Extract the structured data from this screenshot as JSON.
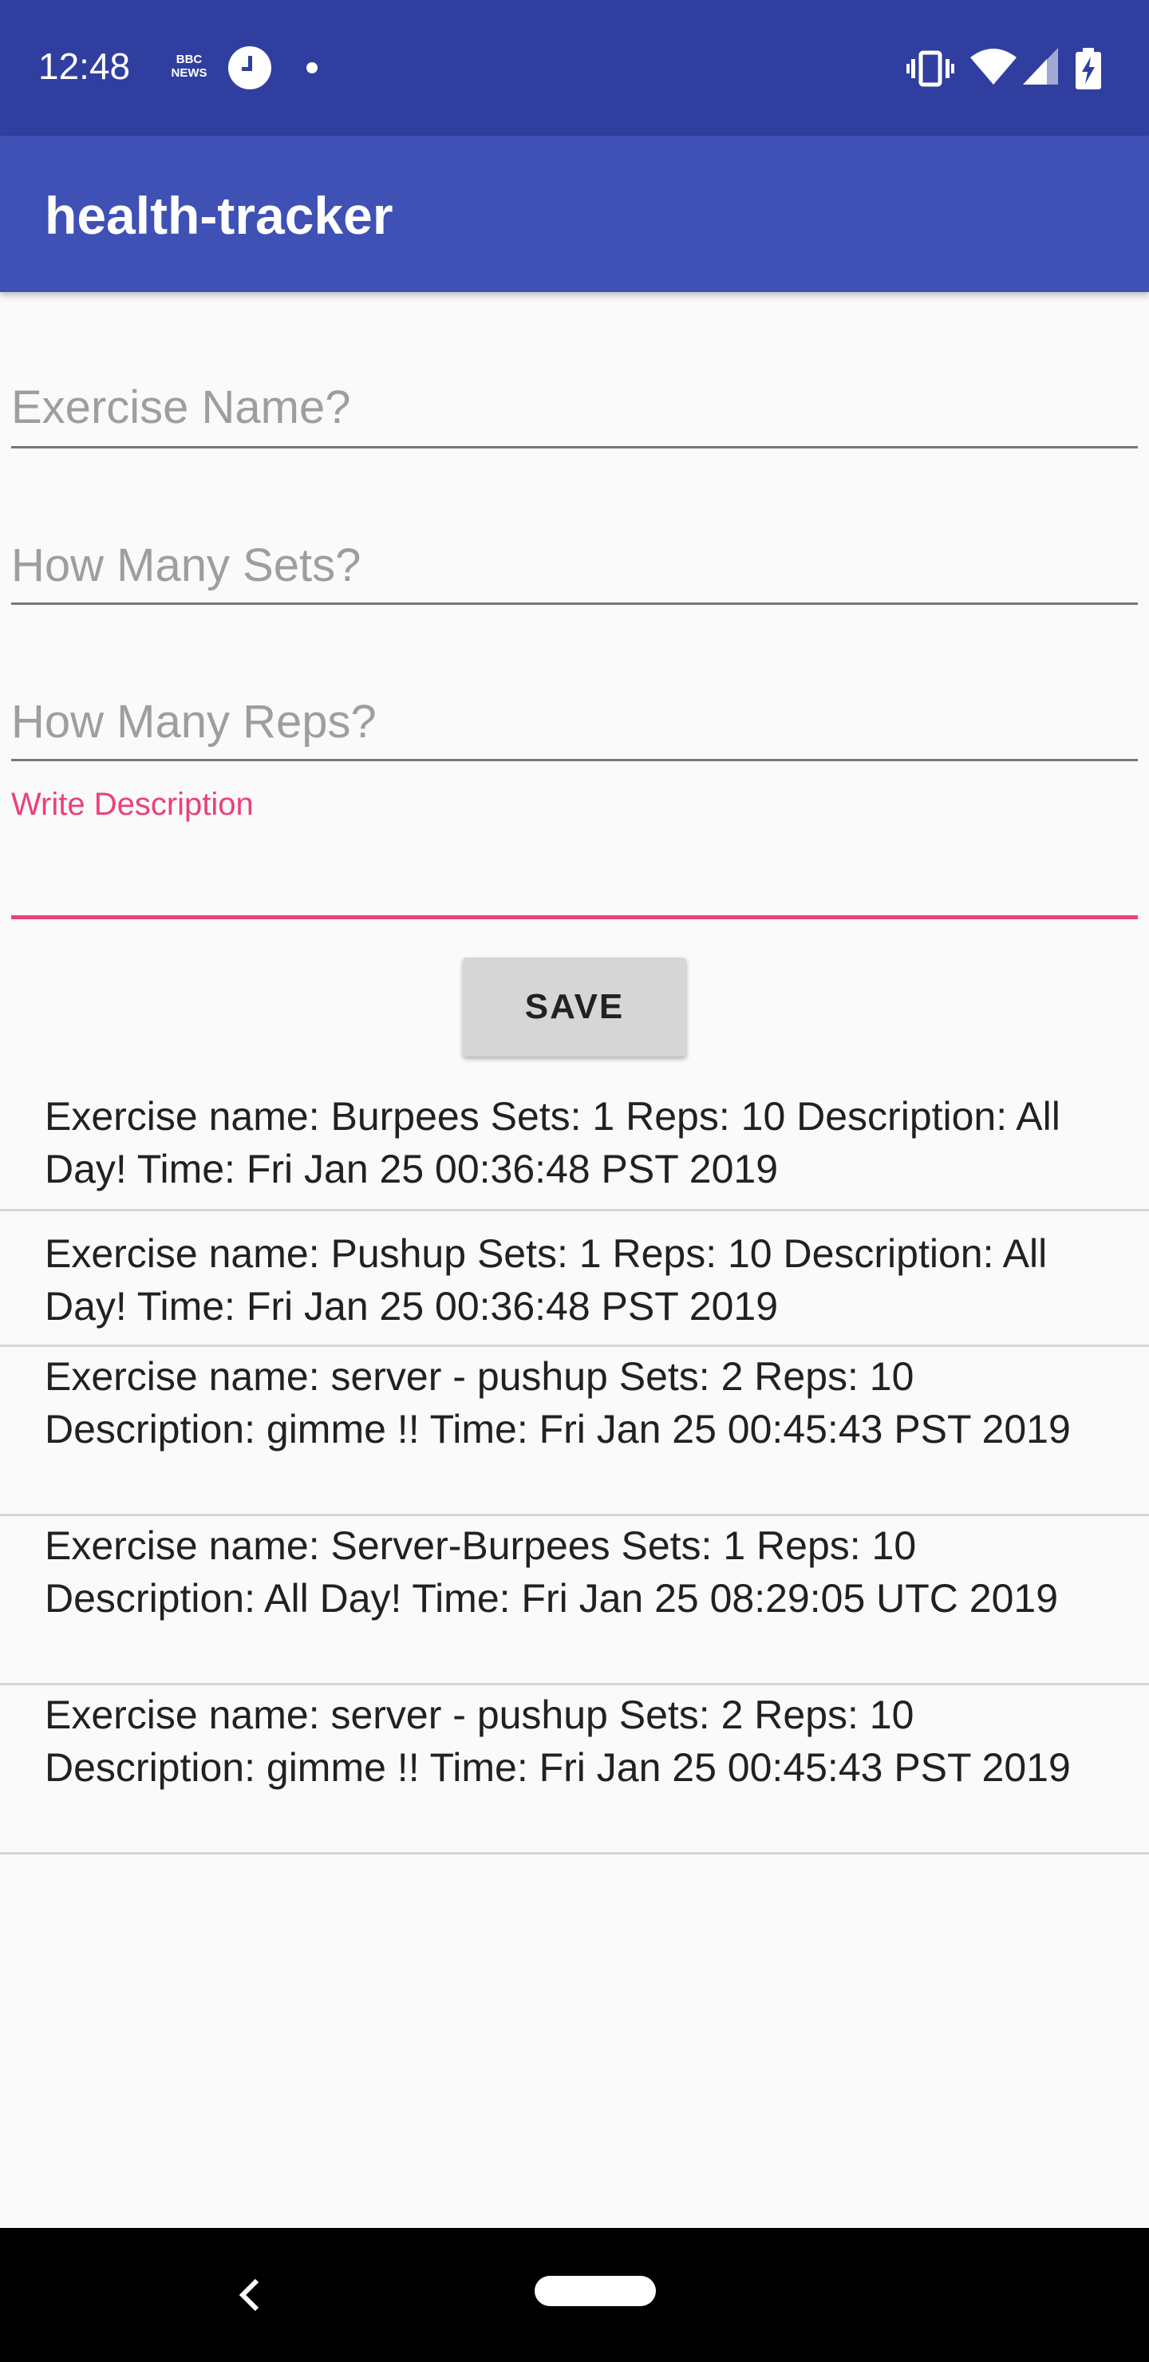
{
  "status_bar": {
    "time": "12:48",
    "notification_icons": [
      "bbc-news-icon",
      "clock-icon",
      "dot-icon"
    ],
    "bbc_label_top": "BBC",
    "bbc_label_bottom": "NEWS",
    "system_icons": [
      "vibrate-icon",
      "wifi-icon",
      "signal-icon",
      "battery-charging-icon"
    ]
  },
  "app_bar": {
    "title": "health-tracker"
  },
  "form": {
    "exercise_name_placeholder": "Exercise Name?",
    "sets_placeholder": "How Many Sets?",
    "reps_placeholder": "How Many Reps?",
    "description_label": "Write Description",
    "description_value": "",
    "save_label": "SAVE"
  },
  "exercises": [
    {
      "text": "Exercise name: Burpees Sets: 1 Reps: 10 Description: All Day! Time: Fri Jan 25 00:36:48 PST 2019"
    },
    {
      "text": "Exercise name: Pushup Sets: 1 Reps: 10 Description: All Day! Time: Fri Jan 25 00:36:48 PST 2019"
    },
    {
      "text": "Exercise name: server - pushup Sets: 2 Reps: 10 Description: gimme !! Time: Fri Jan 25 00:45:43 PST 2019"
    },
    {
      "text": "Exercise name: Server-Burpees Sets: 1 Reps: 10 Description: All Day! Time: Fri Jan 25 08:29:05 UTC 2019"
    },
    {
      "text": "Exercise name: server - pushup Sets: 2 Reps: 10 Description: gimme !! Time: Fri Jan 25 00:45:43 PST 2019"
    }
  ],
  "nav_bar": {
    "icons": [
      "back-icon",
      "home-icon"
    ]
  },
  "colors": {
    "status_bar": "#303f9f",
    "app_bar": "#3f51b5",
    "accent": "#ec407a",
    "background": "#fafafa"
  }
}
